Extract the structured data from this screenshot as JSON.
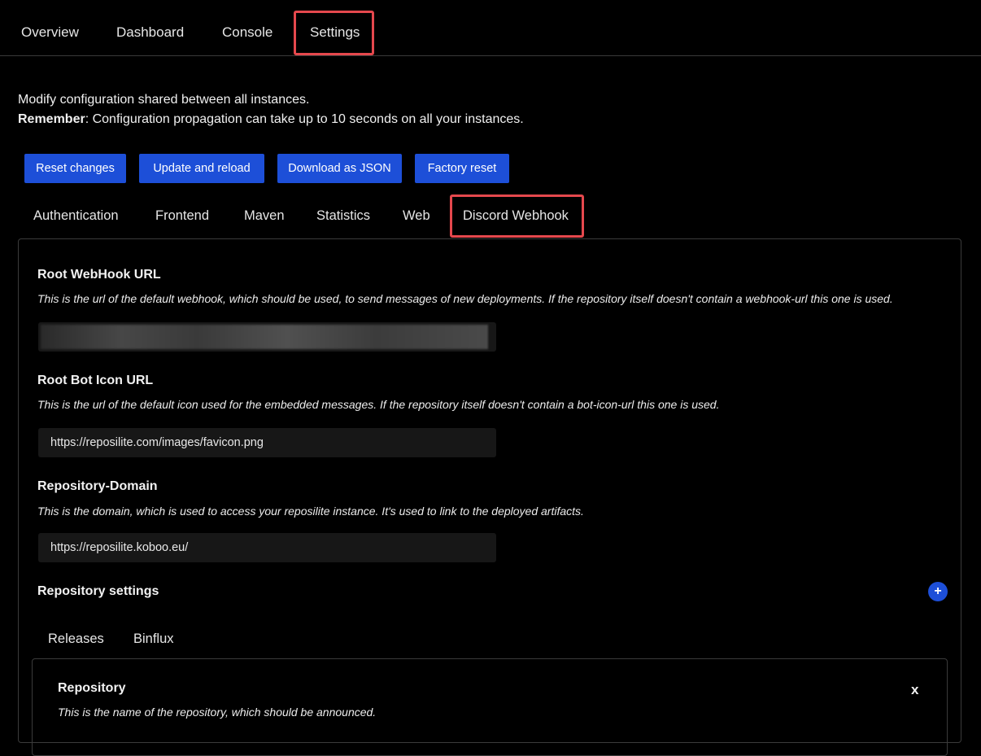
{
  "topnav": {
    "tabs": [
      "Overview",
      "Dashboard",
      "Console",
      "Settings"
    ],
    "active": "Settings"
  },
  "intro": {
    "line1": "Modify configuration shared between all instances.",
    "remember_label": "Remember",
    "remember_text": ": Configuration propagation can take up to 10 seconds on all your instances."
  },
  "actions": [
    "Reset changes",
    "Update and reload",
    "Download as JSON",
    "Factory reset"
  ],
  "subtabs": [
    "Authentication",
    "Frontend",
    "Maven",
    "Statistics",
    "Web",
    "Discord Webhook"
  ],
  "fields": {
    "webhook": {
      "title": "Root WebHook URL",
      "description": "This is the url of the default webhook, which should be used, to send messages of new deployments. If the repository itself doesn't contain a webhook-url this one is used."
    },
    "icon": {
      "title": "Root Bot Icon URL",
      "description": "This is the url of the default icon used for the embedded messages. If the repository itself doesn't contain a bot-icon-url this one is used.",
      "value": "https://reposilite.com/images/favicon.png"
    },
    "domain": {
      "title": "Repository-Domain",
      "description": "This is the domain, which is used to access your reposilite instance. It's used to link to the deployed artifacts.",
      "value": "https://reposilite.koboo.eu/"
    }
  },
  "repo_settings": {
    "title": "Repository settings",
    "add_symbol": "+",
    "tabs": [
      "Releases",
      "Binflux"
    ],
    "repository": {
      "title": "Repository",
      "description": "This is the name of the repository, which should be announced.",
      "close_symbol": "x"
    }
  },
  "colors": {
    "accent": "#1d4fd8",
    "highlight": "#e5484d",
    "background": "#000000"
  }
}
